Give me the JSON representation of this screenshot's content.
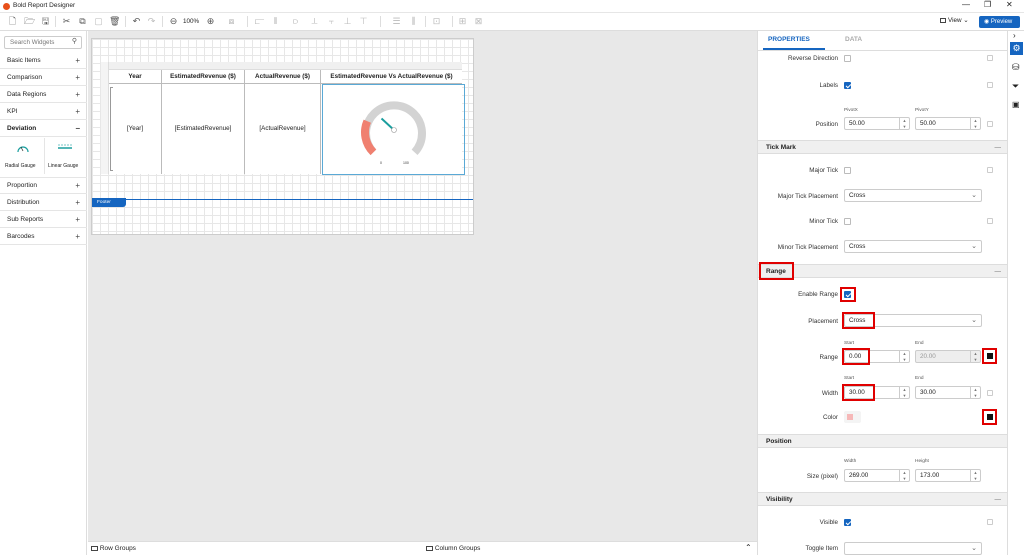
{
  "app": {
    "title": "Bold Report Designer"
  },
  "toolbar": {
    "zoom": "100%",
    "view_label": "View",
    "preview_label": "Preview"
  },
  "widgets": {
    "search_placeholder": "Search Widgets",
    "categories_top": [
      {
        "label": "Basic Items",
        "sign": "+"
      },
      {
        "label": "Comparison",
        "sign": "+"
      },
      {
        "label": "Data Regions",
        "sign": "+"
      },
      {
        "label": "KPI",
        "sign": "+"
      },
      {
        "label": "Deviation",
        "sign": "−"
      }
    ],
    "deviation_items": [
      "Radial Gauge",
      "Linear Gauge"
    ],
    "categories_bottom": [
      {
        "label": "Proportion",
        "sign": "+"
      },
      {
        "label": "Distribution",
        "sign": "+"
      },
      {
        "label": "Sub Reports",
        "sign": "+"
      },
      {
        "label": "Barcodes",
        "sign": "+"
      }
    ]
  },
  "report": {
    "headers": [
      "Year",
      "EstimatedRevenue ($)",
      "ActualRevenue ($)",
      "EstimatedRevenue Vs ActualRevenue ($)"
    ],
    "cells": [
      "[Year]",
      "[EstimatedRevenue]",
      "[ActualRevenue]"
    ],
    "gauge": {
      "min_label": "0",
      "max_label": "100",
      "range_color": "#f08070",
      "track_color": "#d3d3d3",
      "needle_color": "#1a9e9e"
    },
    "footer_label": "Footer"
  },
  "bottombar": {
    "row_groups": "Row Groups",
    "column_groups": "Column Groups"
  },
  "properties": {
    "tabs": [
      "PROPERTIES",
      "DATA"
    ],
    "reverse_direction": "Reverse Direction",
    "labels": "Labels",
    "pivot_x_label": "PivotX",
    "pivot_y_label": "PivotY",
    "position_label": "Position",
    "pivot_x": "50.00",
    "pivot_y": "50.00",
    "tick_mark": {
      "title": "Tick Mark",
      "major_tick": "Major Tick",
      "major_tick_placement": "Major Tick Placement",
      "major_tick_placement_value": "Cross",
      "minor_tick": "Minor Tick",
      "minor_tick_placement": "Minor Tick Placement",
      "minor_tick_placement_value": "Cross"
    },
    "range": {
      "title": "Range",
      "enable_range": "Enable Range",
      "placement": "Placement",
      "placement_value": "Cross",
      "range_label": "Range",
      "start_label": "Start",
      "end_label": "End",
      "range_start": "0.00",
      "range_end": "20.00",
      "width_label": "Width",
      "width_start": "30.00",
      "width_end": "30.00",
      "color_label": "Color"
    },
    "position": {
      "title": "Position",
      "size_label": "Size (pixel)",
      "width_label": "Width",
      "height_label": "Height",
      "width": "269.00",
      "height": "173.00"
    },
    "visibility": {
      "title": "Visibility",
      "visible": "Visible",
      "toggle_item": "Toggle Item"
    }
  }
}
